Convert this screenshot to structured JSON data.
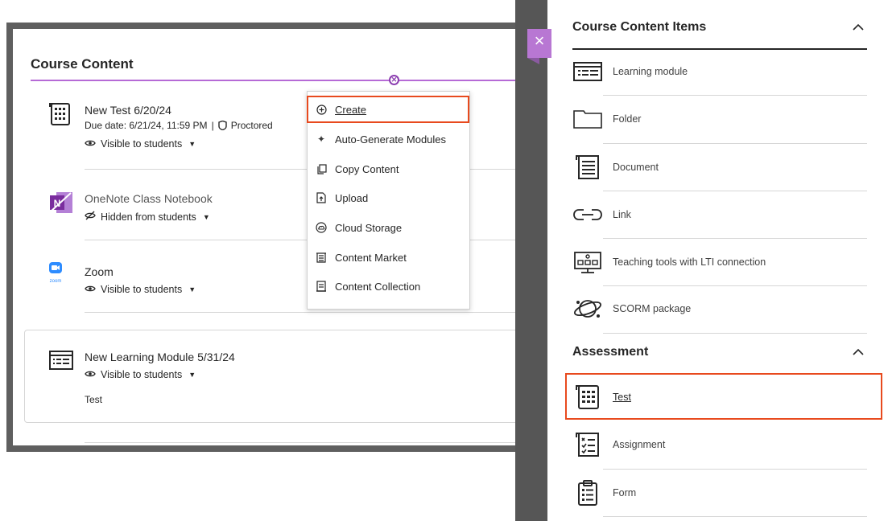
{
  "left": {
    "section_title": "Course Content",
    "items": [
      {
        "title": "New Test 6/20/24",
        "meta": "Due date: 6/21/24, 11:59 PM",
        "badge": "Proctored",
        "visibility": "Visible to students"
      },
      {
        "title": "OneNote Class Notebook",
        "visibility": "Hidden from students"
      },
      {
        "title": "Zoom",
        "icon_caption": "zoom",
        "visibility": "Visible to students"
      },
      {
        "title": "New Learning Module 5/31/24",
        "visibility": "Visible to students",
        "description": "Test"
      }
    ],
    "menu": [
      {
        "label": "Create",
        "icon": "plus-circle-icon"
      },
      {
        "label": "Auto-Generate Modules",
        "icon": "sparkle-icon"
      },
      {
        "label": "Copy Content",
        "icon": "copy-icon"
      },
      {
        "label": "Upload",
        "icon": "upload-icon"
      },
      {
        "label": "Cloud Storage",
        "icon": "cloud-icon"
      },
      {
        "label": "Content Market",
        "icon": "market-icon"
      },
      {
        "label": "Content Collection",
        "icon": "collection-icon"
      }
    ]
  },
  "panel": {
    "close_icon": "close-icon",
    "sections": [
      {
        "title": "Course Content Items",
        "items": [
          {
            "label": "Learning module",
            "icon": "learning-module-icon"
          },
          {
            "label": "Folder",
            "icon": "folder-icon"
          },
          {
            "label": "Document",
            "icon": "document-icon"
          },
          {
            "label": "Link",
            "icon": "link-icon"
          },
          {
            "label": "Teaching tools with LTI connection",
            "icon": "lti-icon"
          },
          {
            "label": "SCORM package",
            "icon": "scorm-icon"
          }
        ]
      },
      {
        "title": "Assessment",
        "items": [
          {
            "label": "Test",
            "icon": "test-icon"
          },
          {
            "label": "Assignment",
            "icon": "assignment-icon"
          },
          {
            "label": "Form",
            "icon": "form-icon"
          }
        ]
      }
    ]
  },
  "colors": {
    "highlight": "#e84a1e",
    "accent_purple": "#b877d3",
    "frame_gray": "#5f5f5f"
  }
}
